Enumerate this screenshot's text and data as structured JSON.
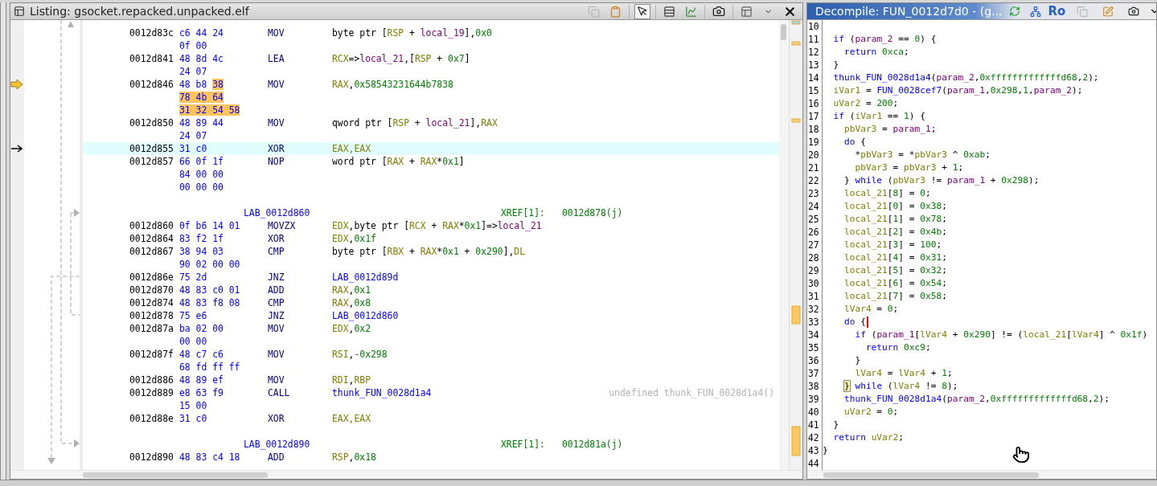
{
  "listing": {
    "title": "Listing: gsocket.repacked.unpacked.elf",
    "tools": [
      {
        "kind": "copy",
        "disabled": true
      },
      {
        "kind": "paste",
        "disabled": false
      },
      {
        "kind": "pointer",
        "on": true
      },
      {
        "kind": "rows"
      },
      {
        "kind": "chart"
      },
      {
        "kind": "camera"
      },
      {
        "kind": "layout"
      }
    ],
    "rows": [
      {
        "kind": "instr",
        "address": "0012d83c",
        "bytes": [
          "c6 44 24",
          "0f 00"
        ],
        "mnemonic": "MOV",
        "operands": [
          {
            "kind": "plain",
            "text": "byte ptr ["
          },
          {
            "kind": "reg",
            "text": "RSP"
          },
          {
            "kind": "plain",
            "text": " + "
          },
          {
            "kind": "local",
            "text": "local_19"
          },
          {
            "kind": "plain",
            "text": "],"
          },
          {
            "kind": "num",
            "text": "0x0"
          }
        ],
        "selected": false
      },
      {
        "kind": "instr",
        "address": "0012d841",
        "bytes": [
          "48 8d 4c",
          "24 07"
        ],
        "mnemonic": "LEA",
        "operands": [
          {
            "kind": "reg",
            "text": "RCX"
          },
          {
            "kind": "plain",
            "text": "=>"
          },
          {
            "kind": "local",
            "text": "local_21"
          },
          {
            "kind": "plain",
            "text": ",["
          },
          {
            "kind": "reg",
            "text": "RSP"
          },
          {
            "kind": "plain",
            "text": " + "
          },
          {
            "kind": "num",
            "text": "0x7"
          },
          {
            "kind": "plain",
            "text": "]"
          }
        ],
        "selected": false
      },
      {
        "kind": "instr",
        "address": "0012d846",
        "bytes": [
          {
            "plain": "48 b8 ",
            "marked": "38"
          },
          {
            "marked": "78 4b 64"
          },
          {
            "marked": "31 32 54 58"
          }
        ],
        "mnemonic": "MOV",
        "operands": [
          {
            "kind": "reg",
            "text": "RAX"
          },
          {
            "kind": "plain",
            "text": ","
          },
          {
            "kind": "num",
            "text": "0x58543231644b7838"
          }
        ],
        "selected": false,
        "marker": {
          "kind": "current"
        }
      },
      {
        "kind": "instr",
        "address": "0012d850",
        "bytes": [
          "48 89 44",
          "24 07"
        ],
        "mnemonic": "MOV",
        "operands": [
          {
            "kind": "plain",
            "text": "qword ptr ["
          },
          {
            "kind": "reg",
            "text": "RSP"
          },
          {
            "kind": "plain",
            "text": " + "
          },
          {
            "kind": "local",
            "text": "local_21"
          },
          {
            "kind": "plain",
            "text": "],"
          },
          {
            "kind": "reg",
            "text": "RAX"
          }
        ],
        "selected": false
      },
      {
        "kind": "instr",
        "address": "0012d855",
        "bytes": [
          "31 c0"
        ],
        "mnemonic": "XOR",
        "operands": [
          {
            "kind": "reg",
            "text": "EAX,EAX"
          }
        ],
        "selected": true,
        "marker": {
          "kind": "cursor"
        }
      },
      {
        "kind": "instr",
        "address": "0012d857",
        "bytes": [
          "66 0f 1f",
          "84 00 00",
          "00 00 00"
        ],
        "mnemonic": "NOP",
        "operands": [
          {
            "kind": "plain",
            "text": "word ptr ["
          },
          {
            "kind": "reg",
            "text": "RAX"
          },
          {
            "kind": "plain",
            "text": " + "
          },
          {
            "kind": "reg",
            "text": "RAX"
          },
          {
            "kind": "plain",
            "text": "*"
          },
          {
            "kind": "num",
            "text": "0x1"
          },
          {
            "kind": "plain",
            "text": "]"
          }
        ],
        "selected": false
      },
      {
        "kind": "blank"
      },
      {
        "kind": "label",
        "label": "LAB_0012d860",
        "xref_label": "XREF[1]:",
        "xref": "0012d878(j)"
      },
      {
        "kind": "instr",
        "address": "0012d860",
        "bytes": [
          "0f b6 14 01"
        ],
        "mnemonic": "MOVZX",
        "operands": [
          {
            "kind": "reg",
            "text": "EDX"
          },
          {
            "kind": "plain",
            "text": ",byte ptr ["
          },
          {
            "kind": "reg",
            "text": "RCX"
          },
          {
            "kind": "plain",
            "text": " + "
          },
          {
            "kind": "reg",
            "text": "RAX"
          },
          {
            "kind": "plain",
            "text": "*"
          },
          {
            "kind": "num",
            "text": "0x1"
          },
          {
            "kind": "plain",
            "text": "]=>"
          },
          {
            "kind": "local",
            "text": "local_21"
          }
        ],
        "selected": false
      },
      {
        "kind": "instr",
        "address": "0012d864",
        "bytes": [
          "83 f2 1f"
        ],
        "mnemonic": "XOR",
        "operands": [
          {
            "kind": "reg",
            "text": "EDX"
          },
          {
            "kind": "plain",
            "text": ","
          },
          {
            "kind": "num",
            "text": "0x1f"
          }
        ],
        "selected": false
      },
      {
        "kind": "instr",
        "address": "0012d867",
        "bytes": [
          "38 94 03",
          "90 02 00 00"
        ],
        "mnemonic": "CMP",
        "operands": [
          {
            "kind": "plain",
            "text": "byte ptr ["
          },
          {
            "kind": "reg",
            "text": "RBX"
          },
          {
            "kind": "plain",
            "text": " + "
          },
          {
            "kind": "reg",
            "text": "RAX"
          },
          {
            "kind": "plain",
            "text": "*"
          },
          {
            "kind": "num",
            "text": "0x1"
          },
          {
            "kind": "plain",
            "text": " + "
          },
          {
            "kind": "num",
            "text": "0x290"
          },
          {
            "kind": "plain",
            "text": "],"
          },
          {
            "kind": "reg",
            "text": "DL"
          }
        ],
        "selected": false
      },
      {
        "kind": "instr",
        "address": "0012d86e",
        "bytes": [
          "75 2d"
        ],
        "mnemonic": "JNZ",
        "operands": [
          {
            "kind": "label",
            "text": "LAB_0012d89d"
          }
        ],
        "selected": false
      },
      {
        "kind": "instr",
        "address": "0012d870",
        "bytes": [
          "48 83 c0 01"
        ],
        "mnemonic": "ADD",
        "operands": [
          {
            "kind": "reg",
            "text": "RAX"
          },
          {
            "kind": "plain",
            "text": ","
          },
          {
            "kind": "num",
            "text": "0x1"
          }
        ],
        "selected": false
      },
      {
        "kind": "instr",
        "address": "0012d874",
        "bytes": [
          "48 83 f8 08"
        ],
        "mnemonic": "CMP",
        "operands": [
          {
            "kind": "reg",
            "text": "RAX"
          },
          {
            "kind": "plain",
            "text": ","
          },
          {
            "kind": "num",
            "text": "0x8"
          }
        ],
        "selected": false
      },
      {
        "kind": "instr",
        "address": "0012d878",
        "bytes": [
          "75 e6"
        ],
        "mnemonic": "JNZ",
        "operands": [
          {
            "kind": "label",
            "text": "LAB_0012d860"
          }
        ],
        "selected": false
      },
      {
        "kind": "instr",
        "address": "0012d87a",
        "bytes": [
          "ba 02 00",
          "00 00"
        ],
        "mnemonic": "MOV",
        "operands": [
          {
            "kind": "reg",
            "text": "EDX"
          },
          {
            "kind": "plain",
            "text": ","
          },
          {
            "kind": "num",
            "text": "0x2"
          }
        ],
        "selected": false
      },
      {
        "kind": "instr",
        "address": "0012d87f",
        "bytes": [
          "48 c7 c6",
          "68 fd ff ff"
        ],
        "mnemonic": "MOV",
        "operands": [
          {
            "kind": "reg",
            "text": "RSI"
          },
          {
            "kind": "plain",
            "text": ","
          },
          {
            "kind": "num",
            "text": "-0x298"
          }
        ],
        "selected": false
      },
      {
        "kind": "instr",
        "address": "0012d886",
        "bytes": [
          "48 89 ef"
        ],
        "mnemonic": "MOV",
        "operands": [
          {
            "kind": "reg",
            "text": "RDI"
          },
          {
            "kind": "plain",
            "text": ","
          },
          {
            "kind": "reg",
            "text": "RBP"
          }
        ],
        "selected": false
      },
      {
        "kind": "instr",
        "address": "0012d889",
        "bytes": [
          "e8 63 f9",
          "15 00"
        ],
        "mnemonic": "CALL",
        "operands": [
          {
            "kind": "label",
            "text": "thunk_FUN_0028d1a4"
          }
        ],
        "selected": false,
        "comment": "undefined thunk_FUN_0028d1a4()"
      },
      {
        "kind": "instr",
        "address": "0012d88e",
        "bytes": [
          "31 c0"
        ],
        "mnemonic": "XOR",
        "operands": [
          {
            "kind": "reg",
            "text": "EAX,EAX"
          }
        ],
        "selected": false
      },
      {
        "kind": "blank"
      },
      {
        "kind": "label",
        "label": "LAB_0012d890",
        "xref_label": "XREF[1]:",
        "xref": "0012d81a(j)"
      },
      {
        "kind": "instr",
        "address": "0012d890",
        "bytes": [
          "48 83 c4 18"
        ],
        "mnemonic": "ADD",
        "operands": [
          {
            "kind": "reg",
            "text": "RSP"
          },
          {
            "kind": "plain",
            "text": ","
          },
          {
            "kind": "num",
            "text": "0x18"
          }
        ],
        "selected": false
      }
    ]
  },
  "decompile": {
    "title": "Decompile: FUN_0012d7d0 - (g...",
    "tools": [
      {
        "kind": "refresh"
      },
      {
        "kind": "graph"
      },
      {
        "kind": "text",
        "label": "Ro"
      },
      {
        "kind": "copy",
        "disabled": true
      },
      {
        "kind": "edit"
      },
      {
        "kind": "camera"
      },
      {
        "kind": "menu"
      }
    ],
    "lines": [
      {
        "number": "10"
      },
      {
        "number": "11",
        "tokens": [
          {
            "kind": "kw",
            "text": "  if"
          },
          {
            "kind": "plain",
            "text": " ("
          },
          {
            "kind": "param",
            "text": "param_2"
          },
          {
            "kind": "plain",
            "text": " == "
          },
          {
            "kind": "num",
            "text": "0"
          },
          {
            "kind": "plain",
            "text": ") {"
          }
        ]
      },
      {
        "number": "12",
        "tokens": [
          {
            "kind": "kw",
            "text": "    return "
          },
          {
            "kind": "num",
            "text": "0xca"
          },
          {
            "kind": "plain",
            "text": ";"
          }
        ]
      },
      {
        "number": "13",
        "tokens": [
          {
            "kind": "plain",
            "text": "  }"
          }
        ]
      },
      {
        "number": "14",
        "tokens": [
          {
            "kind": "fn",
            "text": "  thunk_FUN_0028d1a4"
          },
          {
            "kind": "plain",
            "text": "("
          },
          {
            "kind": "param",
            "text": "param_2"
          },
          {
            "kind": "plain",
            "text": ","
          },
          {
            "kind": "num",
            "text": "0xfffffffffffffd68"
          },
          {
            "kind": "plain",
            "text": ","
          },
          {
            "kind": "num",
            "text": "2"
          },
          {
            "kind": "plain",
            "text": ");"
          }
        ]
      },
      {
        "number": "15",
        "tokens": [
          {
            "kind": "var",
            "text": "  iVar1"
          },
          {
            "kind": "plain",
            "text": " = "
          },
          {
            "kind": "fn",
            "text": "FUN_0028cef7"
          },
          {
            "kind": "plain",
            "text": "("
          },
          {
            "kind": "param",
            "text": "param_1"
          },
          {
            "kind": "plain",
            "text": ","
          },
          {
            "kind": "num",
            "text": "0x298"
          },
          {
            "kind": "plain",
            "text": ","
          },
          {
            "kind": "num",
            "text": "1"
          },
          {
            "kind": "plain",
            "text": ","
          },
          {
            "kind": "param",
            "text": "param_2"
          },
          {
            "kind": "plain",
            "text": ");"
          }
        ]
      },
      {
        "number": "16",
        "tokens": [
          {
            "kind": "var",
            "text": "  uVar2"
          },
          {
            "kind": "plain",
            "text": " = "
          },
          {
            "kind": "num",
            "text": "200"
          },
          {
            "kind": "plain",
            "text": ";"
          }
        ]
      },
      {
        "number": "17",
        "tokens": [
          {
            "kind": "kw",
            "text": "  if"
          },
          {
            "kind": "plain",
            "text": " ("
          },
          {
            "kind": "var",
            "text": "iVar1"
          },
          {
            "kind": "plain",
            "text": " == "
          },
          {
            "kind": "num",
            "text": "1"
          },
          {
            "kind": "plain",
            "text": ") {"
          }
        ]
      },
      {
        "number": "18",
        "tokens": [
          {
            "kind": "var",
            "text": "    pbVar3"
          },
          {
            "kind": "plain",
            "text": " = "
          },
          {
            "kind": "param",
            "text": "param_1"
          },
          {
            "kind": "plain",
            "text": ";"
          }
        ]
      },
      {
        "number": "19",
        "tokens": [
          {
            "kind": "kw",
            "text": "    do"
          },
          {
            "kind": "plain",
            "text": " {"
          }
        ]
      },
      {
        "number": "20",
        "tokens": [
          {
            "kind": "plain",
            "text": "      *"
          },
          {
            "kind": "var",
            "text": "pbVar3"
          },
          {
            "kind": "plain",
            "text": " = *"
          },
          {
            "kind": "var",
            "text": "pbVar3"
          },
          {
            "kind": "plain",
            "text": " ^ "
          },
          {
            "kind": "num",
            "text": "0xab"
          },
          {
            "kind": "plain",
            "text": ";"
          }
        ]
      },
      {
        "number": "21",
        "tokens": [
          {
            "kind": "var",
            "text": "      pbVar3"
          },
          {
            "kind": "plain",
            "text": " = "
          },
          {
            "kind": "var",
            "text": "pbVar3"
          },
          {
            "kind": "plain",
            "text": " + "
          },
          {
            "kind": "num",
            "text": "1"
          },
          {
            "kind": "plain",
            "text": ";"
          }
        ]
      },
      {
        "number": "22",
        "tokens": [
          {
            "kind": "plain",
            "text": "    } "
          },
          {
            "kind": "kw",
            "text": "while"
          },
          {
            "kind": "plain",
            "text": " ("
          },
          {
            "kind": "var",
            "text": "pbVar3"
          },
          {
            "kind": "plain",
            "text": " != "
          },
          {
            "kind": "param",
            "text": "param_1"
          },
          {
            "kind": "plain",
            "text": " + "
          },
          {
            "kind": "num",
            "text": "0x298"
          },
          {
            "kind": "plain",
            "text": ");"
          }
        ]
      },
      {
        "number": "23",
        "tokens": [
          {
            "kind": "var",
            "text": "    local_21"
          },
          {
            "kind": "plain",
            "text": "["
          },
          {
            "kind": "num",
            "text": "8"
          },
          {
            "kind": "plain",
            "text": "] = "
          },
          {
            "kind": "num",
            "text": "0"
          },
          {
            "kind": "plain",
            "text": ";"
          }
        ]
      },
      {
        "number": "24",
        "tokens": [
          {
            "kind": "var",
            "text": "    local_21"
          },
          {
            "kind": "plain",
            "text": "["
          },
          {
            "kind": "num",
            "text": "0"
          },
          {
            "kind": "plain",
            "text": "] = "
          },
          {
            "kind": "num",
            "text": "0x38"
          },
          {
            "kind": "plain",
            "text": ";"
          }
        ]
      },
      {
        "number": "25",
        "tokens": [
          {
            "kind": "var",
            "text": "    local_21"
          },
          {
            "kind": "plain",
            "text": "["
          },
          {
            "kind": "num",
            "text": "1"
          },
          {
            "kind": "plain",
            "text": "] = "
          },
          {
            "kind": "num",
            "text": "0x78"
          },
          {
            "kind": "plain",
            "text": ";"
          }
        ]
      },
      {
        "number": "26",
        "tokens": [
          {
            "kind": "var",
            "text": "    local_21"
          },
          {
            "kind": "plain",
            "text": "["
          },
          {
            "kind": "num",
            "text": "2"
          },
          {
            "kind": "plain",
            "text": "] = "
          },
          {
            "kind": "num",
            "text": "0x4b"
          },
          {
            "kind": "plain",
            "text": ";"
          }
        ]
      },
      {
        "number": "27",
        "tokens": [
          {
            "kind": "var",
            "text": "    local_21"
          },
          {
            "kind": "plain",
            "text": "["
          },
          {
            "kind": "num",
            "text": "3"
          },
          {
            "kind": "plain",
            "text": "] = "
          },
          {
            "kind": "num",
            "text": "100"
          },
          {
            "kind": "plain",
            "text": ";"
          }
        ]
      },
      {
        "number": "28",
        "tokens": [
          {
            "kind": "var",
            "text": "    local_21"
          },
          {
            "kind": "plain",
            "text": "["
          },
          {
            "kind": "num",
            "text": "4"
          },
          {
            "kind": "plain",
            "text": "] = "
          },
          {
            "kind": "num",
            "text": "0x31"
          },
          {
            "kind": "plain",
            "text": ";"
          }
        ]
      },
      {
        "number": "29",
        "tokens": [
          {
            "kind": "var",
            "text": "    local_21"
          },
          {
            "kind": "plain",
            "text": "["
          },
          {
            "kind": "num",
            "text": "5"
          },
          {
            "kind": "plain",
            "text": "] = "
          },
          {
            "kind": "num",
            "text": "0x32"
          },
          {
            "kind": "plain",
            "text": ";"
          }
        ]
      },
      {
        "number": "30",
        "tokens": [
          {
            "kind": "var",
            "text": "    local_21"
          },
          {
            "kind": "plain",
            "text": "["
          },
          {
            "kind": "num",
            "text": "6"
          },
          {
            "kind": "plain",
            "text": "] = "
          },
          {
            "kind": "num",
            "text": "0x54"
          },
          {
            "kind": "plain",
            "text": ";"
          }
        ]
      },
      {
        "number": "31",
        "tokens": [
          {
            "kind": "var",
            "text": "    local_21"
          },
          {
            "kind": "plain",
            "text": "["
          },
          {
            "kind": "num",
            "text": "7"
          },
          {
            "kind": "plain",
            "text": "] = "
          },
          {
            "kind": "num",
            "text": "0x58"
          },
          {
            "kind": "plain",
            "text": ";"
          }
        ]
      },
      {
        "number": "32",
        "tokens": [
          {
            "kind": "var",
            "text": "    lVar4"
          },
          {
            "kind": "plain",
            "text": " = "
          },
          {
            "kind": "num",
            "text": "0"
          },
          {
            "kind": "plain",
            "text": ";"
          }
        ]
      },
      {
        "number": "33",
        "tokens": [
          {
            "kind": "kw",
            "text": "    do"
          },
          {
            "kind": "plain",
            "text": " {"
          }
        ],
        "caret": true
      },
      {
        "number": "34",
        "tokens": [
          {
            "kind": "kw",
            "text": "      if"
          },
          {
            "kind": "plain",
            "text": " ("
          },
          {
            "kind": "param",
            "text": "param_1"
          },
          {
            "kind": "plain",
            "text": "["
          },
          {
            "kind": "var",
            "text": "lVar4"
          },
          {
            "kind": "plain",
            "text": " + "
          },
          {
            "kind": "num",
            "text": "0x290"
          },
          {
            "kind": "plain",
            "text": "] != ("
          },
          {
            "kind": "var",
            "text": "local_21"
          },
          {
            "kind": "plain",
            "text": "["
          },
          {
            "kind": "var",
            "text": "lVar4"
          },
          {
            "kind": "plain",
            "text": "] ^ "
          },
          {
            "kind": "num",
            "text": "0x1f"
          },
          {
            "kind": "plain",
            "text": ")"
          }
        ]
      },
      {
        "number": "35",
        "tokens": [
          {
            "kind": "kw",
            "text": "        return "
          },
          {
            "kind": "num",
            "text": "0xc9"
          },
          {
            "kind": "plain",
            "text": ";"
          }
        ]
      },
      {
        "number": "36",
        "tokens": [
          {
            "kind": "plain",
            "text": "      }"
          }
        ]
      },
      {
        "number": "37",
        "tokens": [
          {
            "kind": "var",
            "text": "      lVar4"
          },
          {
            "kind": "plain",
            "text": " = "
          },
          {
            "kind": "var",
            "text": "lVar4"
          },
          {
            "kind": "plain",
            "text": " + "
          },
          {
            "kind": "num",
            "text": "1"
          },
          {
            "kind": "plain",
            "text": ";"
          }
        ]
      },
      {
        "number": "38",
        "tokens": [
          {
            "kind": "brace",
            "text": "    }"
          },
          {
            "kind": "kw",
            "text": " while"
          },
          {
            "kind": "plain",
            "text": " ("
          },
          {
            "kind": "var",
            "text": "lVar4"
          },
          {
            "kind": "plain",
            "text": " != "
          },
          {
            "kind": "num",
            "text": "8"
          },
          {
            "kind": "plain",
            "text": ");"
          }
        ]
      },
      {
        "number": "39",
        "tokens": [
          {
            "kind": "fn",
            "text": "    thunk_FUN_0028d1a4"
          },
          {
            "kind": "plain",
            "text": "("
          },
          {
            "kind": "param",
            "text": "param_2"
          },
          {
            "kind": "plain",
            "text": ","
          },
          {
            "kind": "num",
            "text": "0xfffffffffffffd68"
          },
          {
            "kind": "plain",
            "text": ","
          },
          {
            "kind": "num",
            "text": "2"
          },
          {
            "kind": "plain",
            "text": ");"
          }
        ]
      },
      {
        "number": "40",
        "tokens": [
          {
            "kind": "var",
            "text": "    uVar2"
          },
          {
            "kind": "plain",
            "text": " = "
          },
          {
            "kind": "num",
            "text": "0"
          },
          {
            "kind": "plain",
            "text": ";"
          }
        ]
      },
      {
        "number": "41",
        "tokens": [
          {
            "kind": "plain",
            "text": "  }"
          }
        ]
      },
      {
        "number": "42",
        "tokens": [
          {
            "kind": "kw",
            "text": "  return "
          },
          {
            "kind": "var",
            "text": "uVar2"
          },
          {
            "kind": "plain",
            "text": ";"
          }
        ]
      },
      {
        "number": "43",
        "tokens": [
          {
            "kind": "plain",
            "text": "}"
          }
        ]
      },
      {
        "number": "44"
      }
    ]
  }
}
